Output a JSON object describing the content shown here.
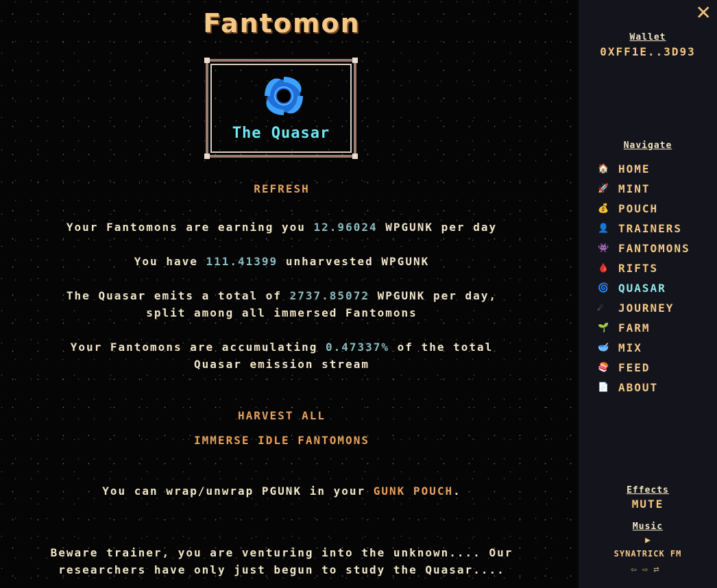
{
  "app_title": "Fantomon",
  "frame": {
    "label": "The Quasar",
    "icon": "quasar-swirl-icon"
  },
  "refresh_label": "REFRESH",
  "earning": {
    "pre": "Your Fantomons are earning you ",
    "value": "12.96024",
    "post": " WPGUNK per day"
  },
  "unharvested": {
    "pre": "You have ",
    "value": "111.41399",
    "post": " unharvested WPGUNK"
  },
  "emission": {
    "pre": "The Quasar emits a total of ",
    "value": "2737.85072",
    "post": " WPGUNK per day,",
    "line2": "split among all immersed Fantomons"
  },
  "accumulating": {
    "pre": "Your Fantomons are accumulating ",
    "value": "0.47337%",
    "post": " of the total",
    "line2": "Quasar emission stream"
  },
  "harvest_all_label": "HARVEST ALL",
  "immerse_label": "IMMERSE IDLE FANTOMONS",
  "wrap_note": {
    "pre": "You can wrap/unwrap PGUNK in your ",
    "link": "GUNK POUCH",
    "post": "."
  },
  "warning": {
    "line1": "Beware trainer, you are venturing into the unknown.... Our",
    "line2": "researchers have only just begun to study the Quasar...."
  },
  "sidebar": {
    "close": "✕",
    "wallet_heading": "Wallet",
    "wallet_address": "0XFF1E..3D93",
    "navigate_heading": "Navigate",
    "nav_items": [
      {
        "label": "HOME",
        "icon": "🏠"
      },
      {
        "label": "MINT",
        "icon": "🚀"
      },
      {
        "label": "POUCH",
        "icon": "💰"
      },
      {
        "label": "TRAINERS",
        "icon": "👤"
      },
      {
        "label": "FANTOMONS",
        "icon": "👾"
      },
      {
        "label": "RIFTS",
        "icon": "🩸"
      },
      {
        "label": "QUASAR",
        "icon": "🌀"
      },
      {
        "label": "JOURNEY",
        "icon": "☄"
      },
      {
        "label": "FARM",
        "icon": "🌱"
      },
      {
        "label": "MIX",
        "icon": "🥣"
      },
      {
        "label": "FEED",
        "icon": "🍣"
      },
      {
        "label": "ABOUT",
        "icon": "📄"
      }
    ],
    "active_item": "QUASAR",
    "effects_heading": "Effects",
    "effects_value": "MUTE",
    "music_heading": "Music",
    "play_symbol": "▶",
    "radio_name": "SYNATRICK FM",
    "prev_symbol": "⇦",
    "next_symbol": "⇨",
    "shuffle_symbol": "⇄"
  }
}
